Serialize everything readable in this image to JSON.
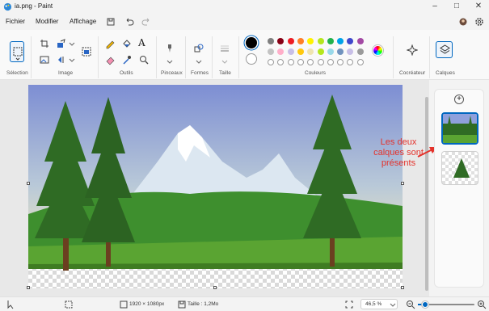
{
  "window": {
    "title": "ia.png - Paint"
  },
  "menu": {
    "file": "Fichier",
    "edit": "Modifier",
    "view": "Affichage"
  },
  "ribbon": {
    "groups": {
      "selection": "Sélection",
      "image": "Image",
      "tools": "Outils",
      "brushes": "Pinceaux",
      "shapes": "Formes",
      "size": "Taille",
      "colors": "Couleurs",
      "creator": "Cocréateur",
      "layers": "Calques"
    },
    "text_tool_glyph": "A",
    "palette_row1": [
      "#7f7f7f",
      "#880015",
      "#ed1c24",
      "#ff7f27",
      "#fff200",
      "#b5e61d",
      "#22b14c",
      "#00a2e8",
      "#3f48cc",
      "#a349a4"
    ],
    "palette_row2": [
      "#c3c3c3",
      "#ffaec9",
      "#c8bfe7",
      "#ffc90e",
      "#efe4b0",
      "#b5e61d",
      "#99d9ea",
      "#7092be",
      "#c8bfe7",
      "#9a9a9a"
    ]
  },
  "colors": {
    "primary": "#000000",
    "secondary": "#ffffff",
    "accent": "#0067c0",
    "annotation": "#e4322b"
  },
  "layers": {
    "add_glyph": "+"
  },
  "annotation": {
    "text": "Les deux calques sont présents"
  },
  "status": {
    "dimensions": "1920 × 1080px",
    "size": "Taille : 1,2Mo",
    "zoom": "46,5 %"
  }
}
